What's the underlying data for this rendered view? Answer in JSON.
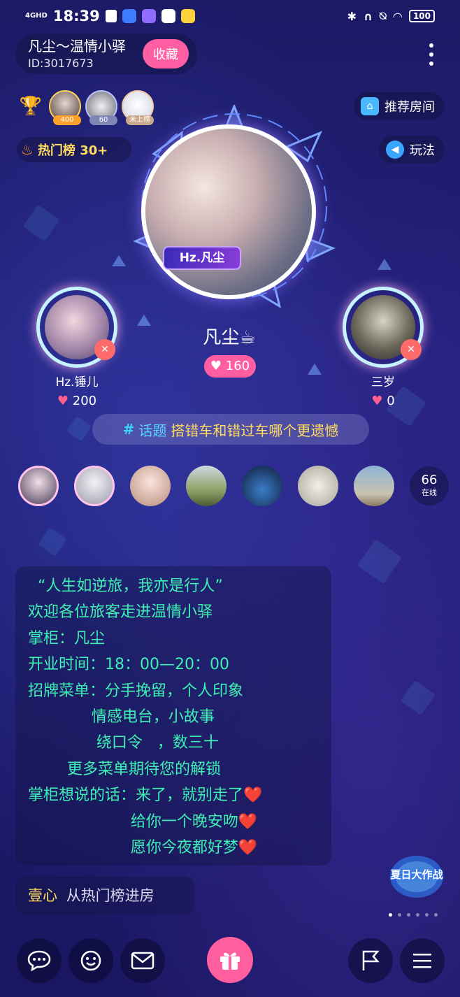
{
  "status_bar": {
    "network": "4GHD",
    "time": "18:39",
    "battery": "100"
  },
  "room": {
    "name": "凡尘～温情小驿",
    "id": "ID:3017673",
    "favorite_label": "收藏"
  },
  "rank": {
    "badges": [
      "400",
      "60",
      "未上榜"
    ]
  },
  "hot_rank": "热门榜 30+",
  "side_buttons": {
    "recommend": "推荐房间",
    "gameplay": "玩法"
  },
  "host": {
    "tag": "Hz.凡尘",
    "name": "凡尘☕",
    "likes": "160"
  },
  "seats": [
    {
      "name": "Hz.锤儿",
      "likes": "200",
      "mic": "off"
    },
    {
      "name": "三岁",
      "likes": "0",
      "mic": "off"
    }
  ],
  "topic": {
    "hash": "#",
    "label": "话题",
    "text": "搭错车和错过车哪个更遗憾"
  },
  "online": {
    "count": "66",
    "label": "在线"
  },
  "notice": {
    "lines": [
      "  “人生如逆旅，我亦是行人”",
      "欢迎各位旅客走进温情小驿",
      "掌柜：凡尘",
      "开业时间：18：00—20：00",
      "招牌菜单：分手挽留，个人印象",
      "             情感电台，小故事",
      "              绕口令   ，数三十",
      "        更多菜单期待您的解锁",
      "掌柜想说的话：来了，就别走了❤️",
      "                     给你一个晚安吻❤️",
      "                     愿你今夜都好梦❤️"
    ]
  },
  "event_badge": "夏日大作战",
  "entry_message": {
    "user": "壹心",
    "action": "从热门榜进房"
  },
  "colors": {
    "accent_pink": "#ff5fa2",
    "notice_green": "#3ef0b4",
    "topic_yellow": "#ffdc5f",
    "topic_cyan": "#58d6ff"
  }
}
